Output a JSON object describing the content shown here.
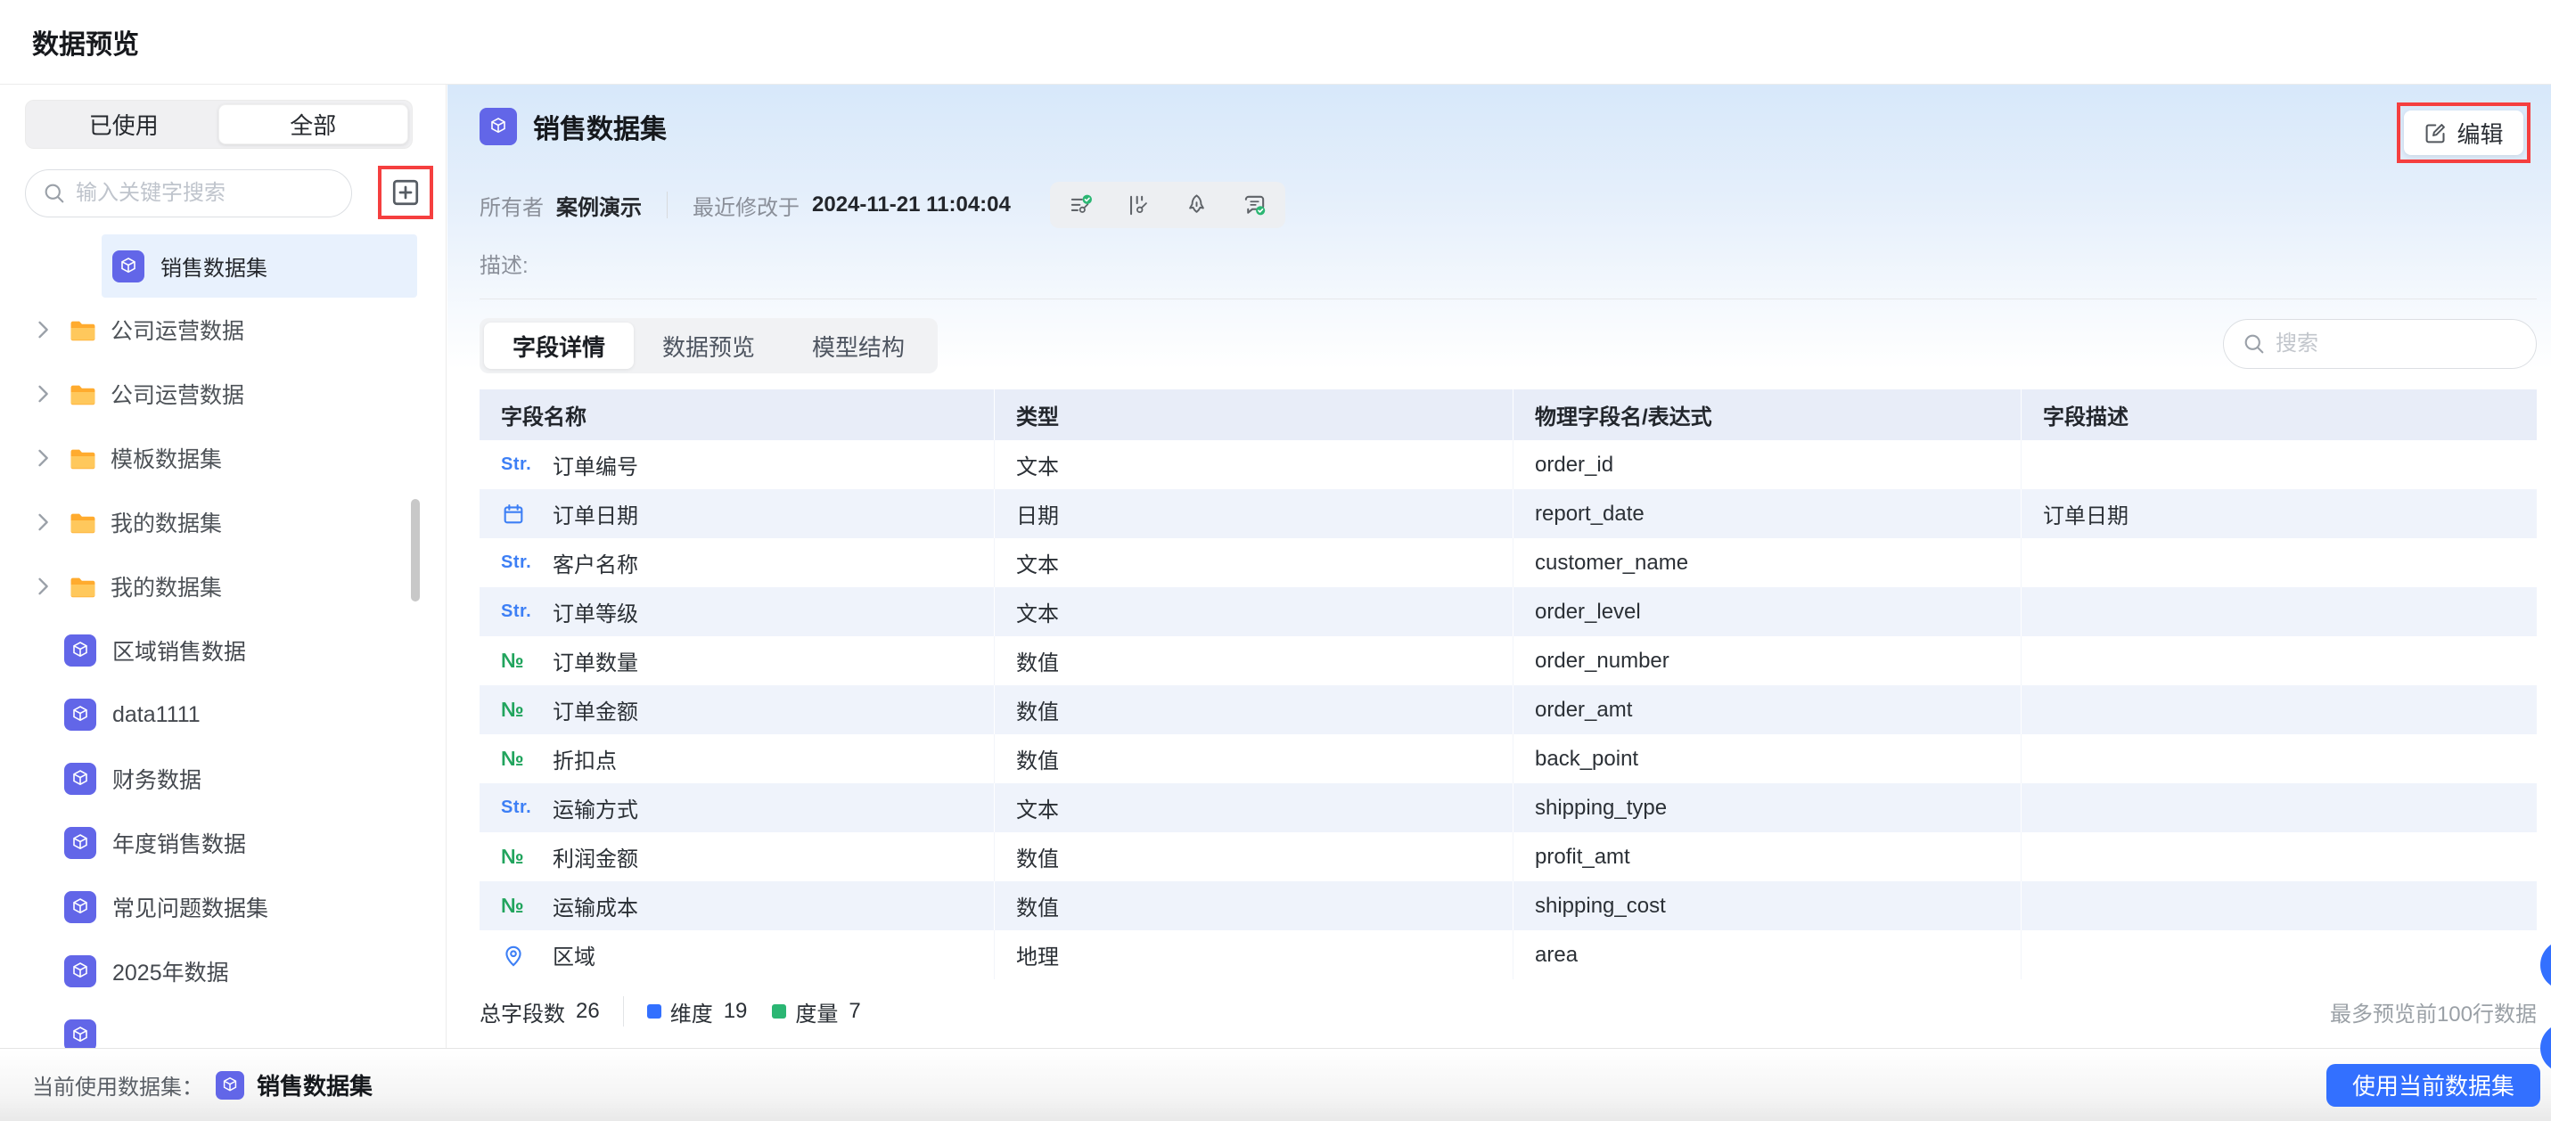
{
  "window": {
    "title": "数据预览"
  },
  "sidebar": {
    "tabs": [
      {
        "label": "已使用"
      },
      {
        "label": "全部"
      }
    ],
    "search_placeholder": "输入关键字搜索",
    "selected_dataset": "销售数据集",
    "folders": [
      "公司运营数据",
      "公司运营数据",
      "模板数据集",
      "我的数据集",
      "我的数据集"
    ],
    "datasets": [
      "区域销售数据",
      "data1111",
      "财务数据",
      "年度销售数据",
      "常见问题数据集",
      "2025年数据"
    ]
  },
  "header": {
    "title": "销售数据集",
    "edit_label": "编辑",
    "owner_label": "所有者",
    "owner": "案例演示",
    "modified_label": "最近修改于",
    "modified": "2024-11-21 11:04:04",
    "description_label": "描述:"
  },
  "tabs": [
    {
      "label": "字段详情"
    },
    {
      "label": "数据预览"
    },
    {
      "label": "模型结构"
    }
  ],
  "table_search_placeholder": "搜索",
  "table": {
    "columns": [
      "字段名称",
      "类型",
      "物理字段名/表达式",
      "字段描述"
    ],
    "rows": [
      {
        "icon_text": "Str.",
        "name": "订单编号",
        "type": "文本",
        "physical": "order_id",
        "desc": ""
      },
      {
        "icon_text": "",
        "name": "订单日期",
        "type": "日期",
        "physical": "report_date",
        "desc": "订单日期"
      },
      {
        "icon_text": "Str.",
        "name": "客户名称",
        "type": "文本",
        "physical": "customer_name",
        "desc": ""
      },
      {
        "icon_text": "Str.",
        "name": "订单等级",
        "type": "文本",
        "physical": "order_level",
        "desc": ""
      },
      {
        "icon_text": "№",
        "name": "订单数量",
        "type": "数值",
        "physical": "order_number",
        "desc": ""
      },
      {
        "icon_text": "№",
        "name": "订单金额",
        "type": "数值",
        "physical": "order_amt",
        "desc": ""
      },
      {
        "icon_text": "№",
        "name": "折扣点",
        "type": "数值",
        "physical": "back_point",
        "desc": ""
      },
      {
        "icon_text": "Str.",
        "name": "运输方式",
        "type": "文本",
        "physical": "shipping_type",
        "desc": ""
      },
      {
        "icon_text": "№",
        "name": "利润金额",
        "type": "数值",
        "physical": "profit_amt",
        "desc": ""
      },
      {
        "icon_text": "№",
        "name": "运输成本",
        "type": "数值",
        "physical": "shipping_cost",
        "desc": ""
      },
      {
        "icon_text": "",
        "name": "区域",
        "type": "地理",
        "physical": "area",
        "desc": ""
      }
    ]
  },
  "footer": {
    "total_label": "总字段数",
    "total": "26",
    "dimension_label": "维度",
    "dimension": "19",
    "measure_label": "度量",
    "measure": "7",
    "note": "最多预览前100行数据"
  },
  "bottom_bar": {
    "current_label": "当前使用数据集：",
    "dataset": "销售数据集",
    "use_button": "使用当前数据集"
  },
  "colors": {
    "accent_blue": "#3370FF",
    "annotation_red": "#F53F3F",
    "dataset_icon_indigo": "#6266E8",
    "folder_orange": "#FFAB2E",
    "dimension_blue": "#3370FF",
    "measure_green": "#2BB673",
    "selected_item_bg": "#E8F1FD",
    "table_stripe": "#EFF3FB"
  }
}
